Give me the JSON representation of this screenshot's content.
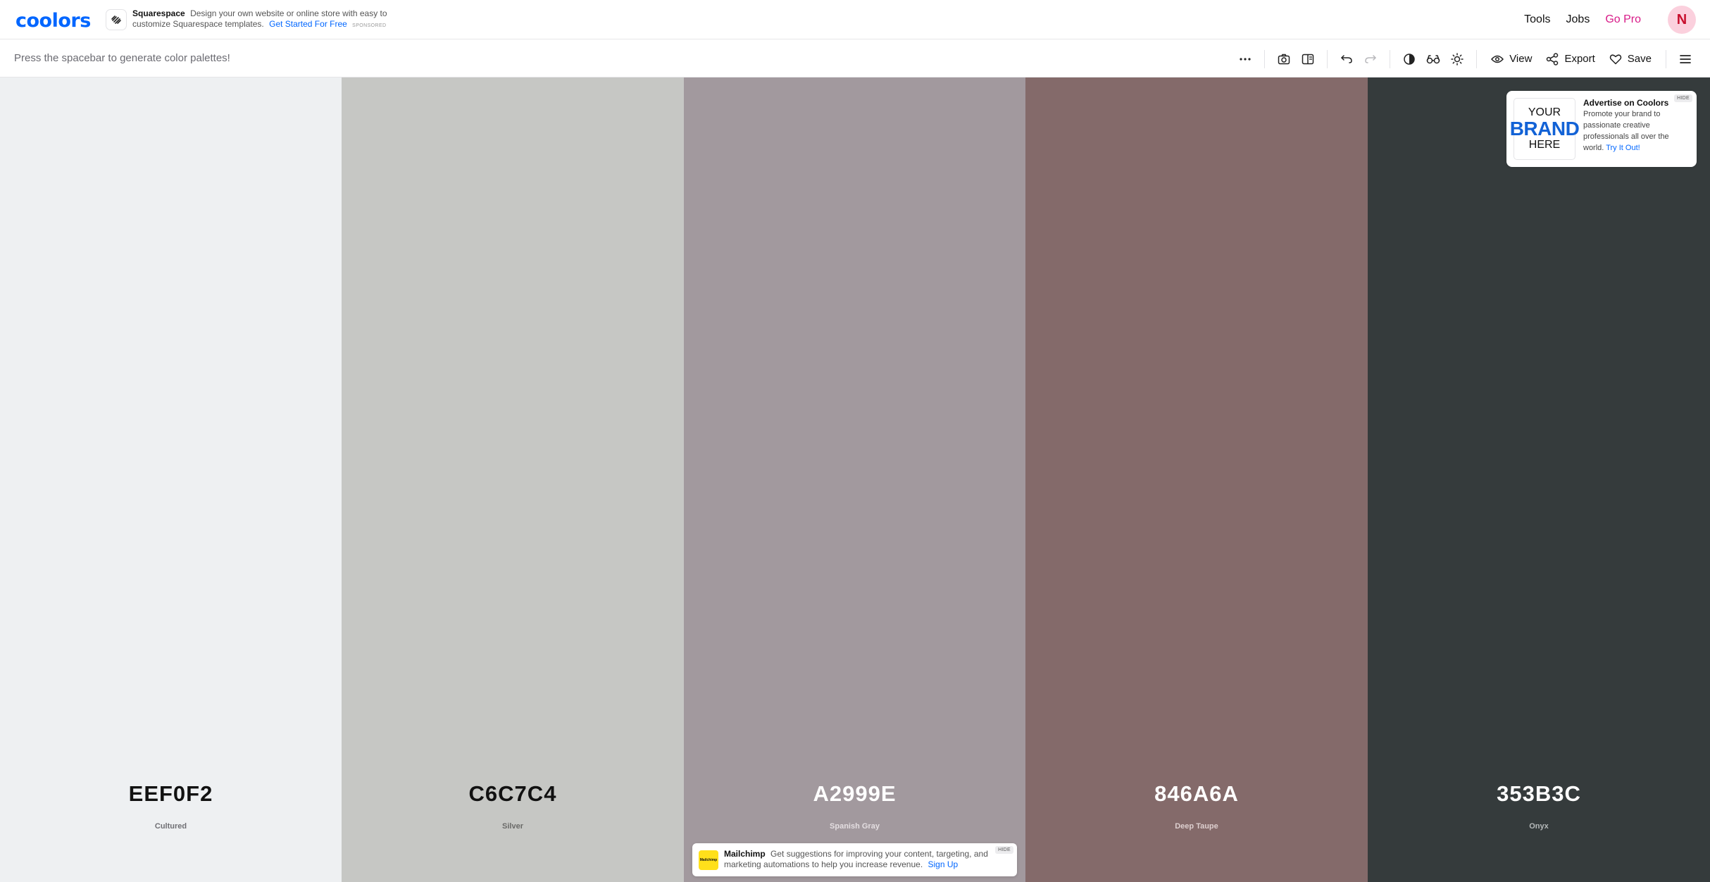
{
  "app": {
    "logo": "coolors"
  },
  "sponsor": {
    "name": "Squarespace",
    "text": "Design your own website or online store with easy to customize Squarespace templates.",
    "link": "Get Started For Free",
    "tag": "SPONSORED"
  },
  "nav": {
    "tools": "Tools",
    "jobs": "Jobs",
    "pro": "Go Pro",
    "avatar": "N"
  },
  "toolbar": {
    "hint": "Press the spacebar to generate color palettes!",
    "view": "View",
    "export": "Export",
    "save": "Save"
  },
  "palette": [
    {
      "hex": "EEF0F2",
      "name": "Cultured",
      "color": "#EEF0F2",
      "text_color": "#111111",
      "name_color": "#6f6f74"
    },
    {
      "hex": "C6C7C4",
      "name": "Silver",
      "color": "#C6C7C4",
      "text_color": "#111111",
      "name_color": "#6a6a68"
    },
    {
      "hex": "A2999E",
      "name": "Spanish Gray",
      "color": "#A2999E",
      "text_color": "#ffffff",
      "name_color": "#e4dee1"
    },
    {
      "hex": "846A6A",
      "name": "Deep Taupe",
      "color": "#846A6A",
      "text_color": "#ffffff",
      "name_color": "#ddcfcf"
    },
    {
      "hex": "353B3C",
      "name": "Onyx",
      "color": "#353B3C",
      "text_color": "#ffffff",
      "name_color": "#b5b9ba"
    }
  ],
  "ad_card": {
    "thumb_line1": "YOUR",
    "thumb_line2": "BRAND",
    "thumb_line3": "HERE",
    "title": "Advertise on Coolors",
    "text": "Promote your brand to passionate creative professionals all over the world.",
    "link": "Try It Out!",
    "hide": "HIDE"
  },
  "bottom_ad": {
    "logo_text": "Mailchimp",
    "name": "Mailchimp",
    "text": "Get suggestions for improving your content, targeting, and marketing automations to help you increase revenue.",
    "link": "Sign Up",
    "hide": "HIDE"
  }
}
